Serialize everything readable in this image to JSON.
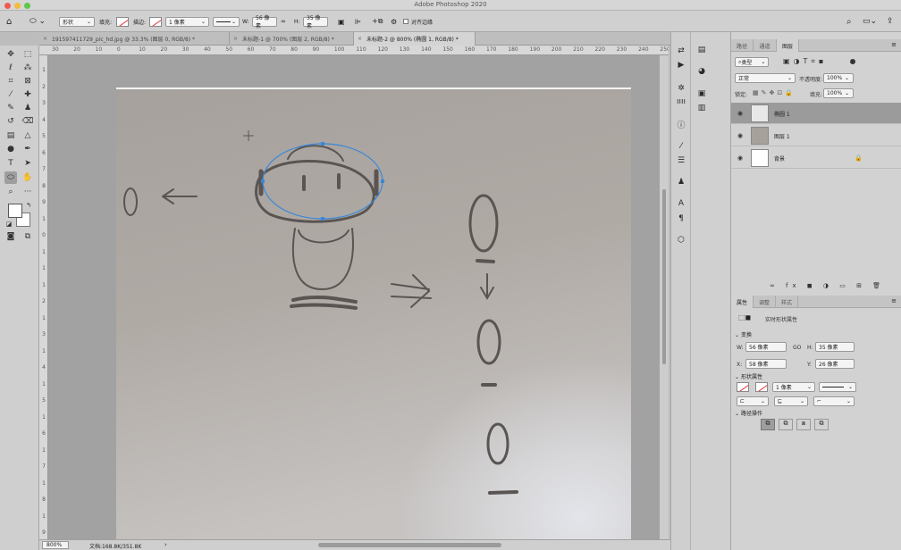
{
  "app": {
    "title": "Adobe Photoshop 2020",
    "accent": "#3b87d8"
  },
  "options": {
    "mode": "形状",
    "fill_label": "填充:",
    "stroke_label": "描边:",
    "stroke_width": "1 像素",
    "w_label": "W:",
    "w_value": "56 像素",
    "h_label": "H:",
    "h_value": "35 像素",
    "align_edges": "对齐边缘"
  },
  "tabs": [
    {
      "label": "191597411729_pic_hd.jpg @ 33.3% (图层 0, RGB/8) *",
      "active": false
    },
    {
      "label": "未标题-1 @ 700% (图层 2, RGB/8) *",
      "active": false
    },
    {
      "label": "未标题-2 @ 800% (椭圆 1, RGB/8) *",
      "active": true
    }
  ],
  "ruler": {
    "h_ticks": [
      "30",
      "20",
      "10",
      "0",
      "10",
      "20",
      "30",
      "40",
      "50",
      "60",
      "70",
      "80",
      "90",
      "100",
      "110",
      "120",
      "130",
      "140",
      "150",
      "160",
      "170",
      "180",
      "190",
      "200",
      "210",
      "220",
      "230",
      "240",
      "250"
    ],
    "v_ticks": [
      "1",
      "2",
      "3",
      "4",
      "5",
      "6",
      "7",
      "8",
      "9",
      "1",
      "0",
      "1",
      "1",
      "1",
      "2",
      "1",
      "3",
      "1",
      "4",
      "1",
      "5",
      "1",
      "6",
      "1",
      "7",
      "1",
      "8",
      "1",
      "9"
    ]
  },
  "status": {
    "zoom": "800%",
    "doc": "文档:168.8K/351.8K",
    "arrow": "›"
  },
  "layers_panel": {
    "tabs": [
      "路径",
      "通道",
      "图层"
    ],
    "kind": "类型",
    "blend": "正常",
    "opacity_label": "不透明度:",
    "opacity": "100%",
    "lock_label": "锁定:",
    "fill_label": "填充:",
    "fill": "100%",
    "layers": [
      {
        "name": "椭圆 1",
        "selected": true
      },
      {
        "name": "图层 1",
        "selected": false
      },
      {
        "name": "背景",
        "selected": false
      }
    ]
  },
  "props_panel": {
    "tabs": [
      "属性",
      "调整",
      "样式"
    ],
    "header": "实时形状属性",
    "transform_label": "变换",
    "w_label": "W:",
    "w_value": "56 像素",
    "go_label": "GO",
    "h_label": "H:",
    "h_value": "35 像素",
    "x_label": "X:",
    "x_value": "58 像素",
    "y_label": "Y:",
    "y_value": "26 像素",
    "appearance_label": "形状属性",
    "stroke_width": "1 像素",
    "pathops_label": "路径操作"
  }
}
